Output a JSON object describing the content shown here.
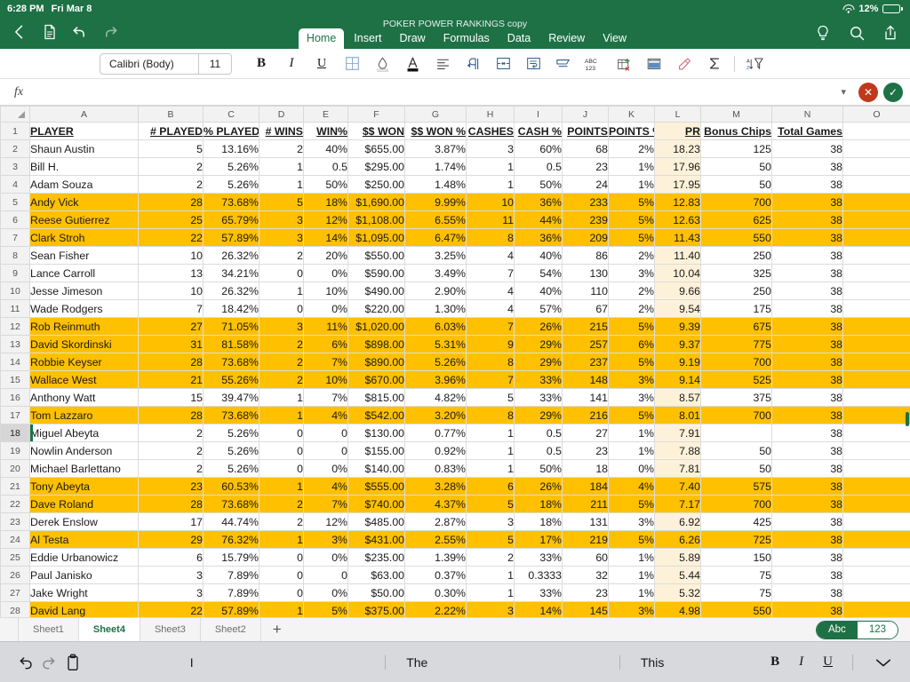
{
  "status_bar": {
    "time": "6:28 PM",
    "date": "Fri Mar 8",
    "battery": "12%"
  },
  "ribbon": {
    "document_title": "POKER POWER RANKINGS copy",
    "tabs": [
      "Home",
      "Insert",
      "Draw",
      "Formulas",
      "Data",
      "Review",
      "View"
    ],
    "active_tab": "Home"
  },
  "format_bar": {
    "font_name": "Calibri (Body)",
    "font_size": "11"
  },
  "formula_bar": {
    "value": "",
    "placeholder": ""
  },
  "grid": {
    "column_letters": [
      "A",
      "B",
      "C",
      "D",
      "E",
      "F",
      "G",
      "H",
      "I",
      "J",
      "K",
      "L",
      "M",
      "N",
      "O"
    ],
    "headers": [
      "PLAYER",
      "# PLAYED",
      "% PLAYED",
      "# WINS",
      "WIN%",
      "$$ WON",
      "$$ WON %",
      "CASHES",
      "CASH %",
      "POINTS",
      "POINTS %",
      "PR",
      "Bonus Chips",
      "Total Games",
      ""
    ],
    "rows": [
      {
        "n": "1",
        "hl": false,
        "header": true,
        "cells": [
          "PLAYER",
          "# PLAYED",
          "% PLAYED",
          "# WINS",
          "WIN%",
          "$$ WON",
          "$$ WON %",
          "CASHES",
          "CASH %",
          "POINTS",
          "POINTS %",
          "PR",
          "Bonus Chips",
          "Total Games",
          ""
        ]
      },
      {
        "n": "2",
        "hl": false,
        "cells": [
          "Shaun Austin",
          "5",
          "13.16%",
          "2",
          "40%",
          "$655.00",
          "3.87%",
          "3",
          "60%",
          "68",
          "2%",
          "18.23",
          "125",
          "38",
          ""
        ]
      },
      {
        "n": "3",
        "hl": false,
        "cells": [
          "Bill H.",
          "2",
          "5.26%",
          "1",
          "0.5",
          "$295.00",
          "1.74%",
          "1",
          "0.5",
          "23",
          "1%",
          "17.96",
          "50",
          "38",
          ""
        ]
      },
      {
        "n": "4",
        "hl": false,
        "cells": [
          "Adam Souza",
          "2",
          "5.26%",
          "1",
          "50%",
          "$250.00",
          "1.48%",
          "1",
          "50%",
          "24",
          "1%",
          "17.95",
          "50",
          "38",
          ""
        ]
      },
      {
        "n": "5",
        "hl": true,
        "cells": [
          "Andy Vick",
          "28",
          "73.68%",
          "5",
          "18%",
          "$1,690.00",
          "9.99%",
          "10",
          "36%",
          "233",
          "5%",
          "12.83",
          "700",
          "38",
          ""
        ]
      },
      {
        "n": "6",
        "hl": true,
        "cells": [
          "Reese Gutierrez",
          "25",
          "65.79%",
          "3",
          "12%",
          "$1,108.00",
          "6.55%",
          "11",
          "44%",
          "239",
          "5%",
          "12.63",
          "625",
          "38",
          ""
        ]
      },
      {
        "n": "7",
        "hl": true,
        "cells": [
          "Clark Stroh",
          "22",
          "57.89%",
          "3",
          "14%",
          "$1,095.00",
          "6.47%",
          "8",
          "36%",
          "209",
          "5%",
          "11.43",
          "550",
          "38",
          ""
        ]
      },
      {
        "n": "8",
        "hl": false,
        "cells": [
          "Sean Fisher",
          "10",
          "26.32%",
          "2",
          "20%",
          "$550.00",
          "3.25%",
          "4",
          "40%",
          "86",
          "2%",
          "11.40",
          "250",
          "38",
          ""
        ]
      },
      {
        "n": "9",
        "hl": false,
        "cells": [
          "Lance Carroll",
          "13",
          "34.21%",
          "0",
          "0%",
          "$590.00",
          "3.49%",
          "7",
          "54%",
          "130",
          "3%",
          "10.04",
          "325",
          "38",
          ""
        ]
      },
      {
        "n": "10",
        "hl": false,
        "cells": [
          "Jesse Jimeson",
          "10",
          "26.32%",
          "1",
          "10%",
          "$490.00",
          "2.90%",
          "4",
          "40%",
          "110",
          "2%",
          "9.66",
          "250",
          "38",
          ""
        ]
      },
      {
        "n": "11",
        "hl": false,
        "cells": [
          "Wade Rodgers",
          "7",
          "18.42%",
          "0",
          "0%",
          "$220.00",
          "1.30%",
          "4",
          "57%",
          "67",
          "2%",
          "9.54",
          "175",
          "38",
          ""
        ]
      },
      {
        "n": "12",
        "hl": true,
        "cells": [
          "Rob Reinmuth",
          "27",
          "71.05%",
          "3",
          "11%",
          "$1,020.00",
          "6.03%",
          "7",
          "26%",
          "215",
          "5%",
          "9.39",
          "675",
          "38",
          ""
        ]
      },
      {
        "n": "13",
        "hl": true,
        "cells": [
          "David Skordinski",
          "31",
          "81.58%",
          "2",
          "6%",
          "$898.00",
          "5.31%",
          "9",
          "29%",
          "257",
          "6%",
          "9.37",
          "775",
          "38",
          ""
        ]
      },
      {
        "n": "14",
        "hl": true,
        "cells": [
          "Robbie Keyser",
          "28",
          "73.68%",
          "2",
          "7%",
          "$890.00",
          "5.26%",
          "8",
          "29%",
          "237",
          "5%",
          "9.19",
          "700",
          "38",
          ""
        ]
      },
      {
        "n": "15",
        "hl": true,
        "cells": [
          "Wallace West",
          "21",
          "55.26%",
          "2",
          "10%",
          "$670.00",
          "3.96%",
          "7",
          "33%",
          "148",
          "3%",
          "9.14",
          "525",
          "38",
          ""
        ]
      },
      {
        "n": "16",
        "hl": false,
        "cells": [
          "Anthony Watt",
          "15",
          "39.47%",
          "1",
          "7%",
          "$815.00",
          "4.82%",
          "5",
          "33%",
          "141",
          "3%",
          "8.57",
          "375",
          "38",
          ""
        ]
      },
      {
        "n": "17",
        "hl": true,
        "cells": [
          "Tom Lazzaro",
          "28",
          "73.68%",
          "1",
          "4%",
          "$542.00",
          "3.20%",
          "8",
          "29%",
          "216",
          "5%",
          "8.01",
          "700",
          "38",
          ""
        ]
      },
      {
        "n": "18",
        "hl": false,
        "sel": true,
        "cells": [
          "Miguel Abeyta",
          "2",
          "5.26%",
          "0",
          "0",
          "$130.00",
          "0.77%",
          "1",
          "0.5",
          "27",
          "1%",
          "7.91",
          "",
          "38",
          ""
        ]
      },
      {
        "n": "19",
        "hl": false,
        "cells": [
          "Nowlin Anderson",
          "2",
          "5.26%",
          "0",
          "0",
          "$155.00",
          "0.92%",
          "1",
          "0.5",
          "23",
          "1%",
          "7.88",
          "50",
          "38",
          ""
        ]
      },
      {
        "n": "20",
        "hl": false,
        "cells": [
          "Michael Barlettano",
          "2",
          "5.26%",
          "0",
          "0%",
          "$140.00",
          "0.83%",
          "1",
          "50%",
          "18",
          "0%",
          "7.81",
          "50",
          "38",
          ""
        ]
      },
      {
        "n": "21",
        "hl": true,
        "cells": [
          "Tony Abeyta",
          "23",
          "60.53%",
          "1",
          "4%",
          "$555.00",
          "3.28%",
          "6",
          "26%",
          "184",
          "4%",
          "7.40",
          "575",
          "38",
          ""
        ]
      },
      {
        "n": "22",
        "hl": true,
        "cells": [
          "Dave Roland",
          "28",
          "73.68%",
          "2",
          "7%",
          "$740.00",
          "4.37%",
          "5",
          "18%",
          "211",
          "5%",
          "7.17",
          "700",
          "38",
          ""
        ]
      },
      {
        "n": "23",
        "hl": false,
        "cells": [
          "Derek Enslow",
          "17",
          "44.74%",
          "2",
          "12%",
          "$485.00",
          "2.87%",
          "3",
          "18%",
          "131",
          "3%",
          "6.92",
          "425",
          "38",
          ""
        ]
      },
      {
        "n": "24",
        "hl": true,
        "cells": [
          "Al Testa",
          "29",
          "76.32%",
          "1",
          "3%",
          "$431.00",
          "2.55%",
          "5",
          "17%",
          "219",
          "5%",
          "6.26",
          "725",
          "38",
          ""
        ]
      },
      {
        "n": "25",
        "hl": false,
        "cells": [
          "Eddie Urbanowicz",
          "6",
          "15.79%",
          "0",
          "0%",
          "$235.00",
          "1.39%",
          "2",
          "33%",
          "60",
          "1%",
          "5.89",
          "150",
          "38",
          ""
        ]
      },
      {
        "n": "26",
        "hl": false,
        "cells": [
          "Paul Janisko",
          "3",
          "7.89%",
          "0",
          "0",
          "$63.00",
          "0.37%",
          "1",
          "0.3333",
          "32",
          "1%",
          "5.44",
          "75",
          "38",
          ""
        ]
      },
      {
        "n": "27",
        "hl": false,
        "cells": [
          "Jake Wright",
          "3",
          "7.89%",
          "0",
          "0%",
          "$50.00",
          "0.30%",
          "1",
          "33%",
          "23",
          "1%",
          "5.32",
          "75",
          "38",
          ""
        ]
      },
      {
        "n": "28",
        "hl": true,
        "cells": [
          "David Lang",
          "22",
          "57.89%",
          "1",
          "5%",
          "$375.00",
          "2.22%",
          "3",
          "14%",
          "145",
          "3%",
          "4.98",
          "550",
          "38",
          ""
        ]
      }
    ]
  },
  "sheet_tabs": {
    "tabs": [
      "Sheet1",
      "Sheet4",
      "Sheet3",
      "Sheet2"
    ],
    "active": "Sheet4",
    "add_label": "+"
  },
  "input_mode": {
    "text_label": "Abc",
    "number_label": "123",
    "active": "Abc"
  },
  "keyboard_bar": {
    "suggestions": [
      "I",
      "The",
      "This"
    ],
    "bold": "B",
    "italic": "I",
    "underline": "U"
  },
  "colors": {
    "brand_green": "#1E7145",
    "highlight_orange": "#FFC000",
    "pr_column": "#FDF2D9"
  }
}
